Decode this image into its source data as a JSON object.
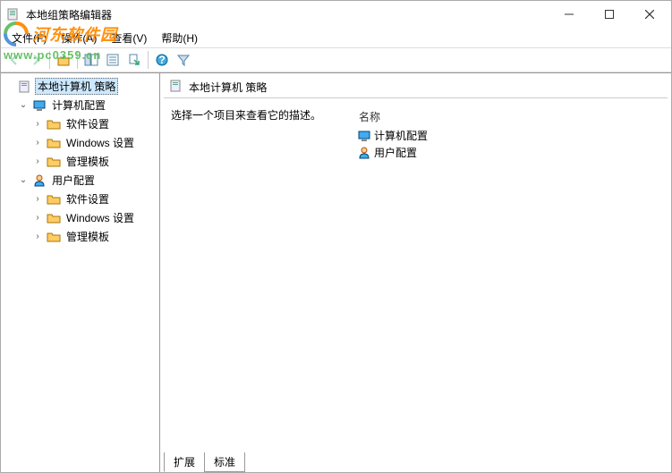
{
  "window": {
    "title": "本地组策略编辑器"
  },
  "menubar": {
    "file": "文件(F)",
    "action": "操作(A)",
    "view": "查看(V)",
    "help": "帮助(H)"
  },
  "tree": {
    "root": "本地计算机 策略",
    "computer": "计算机配置",
    "user": "用户配置",
    "software": "软件设置",
    "windows": "Windows 设置",
    "templates": "管理模板"
  },
  "detail": {
    "header": "本地计算机 策略",
    "description": "选择一个项目来查看它的描述。",
    "column_name": "名称",
    "items": {
      "computer": "计算机配置",
      "user": "用户配置"
    }
  },
  "tabs": {
    "extended": "扩展",
    "standard": "标准"
  },
  "watermark": {
    "brand": "河东软件园",
    "url": "www.pc0359.cn"
  }
}
